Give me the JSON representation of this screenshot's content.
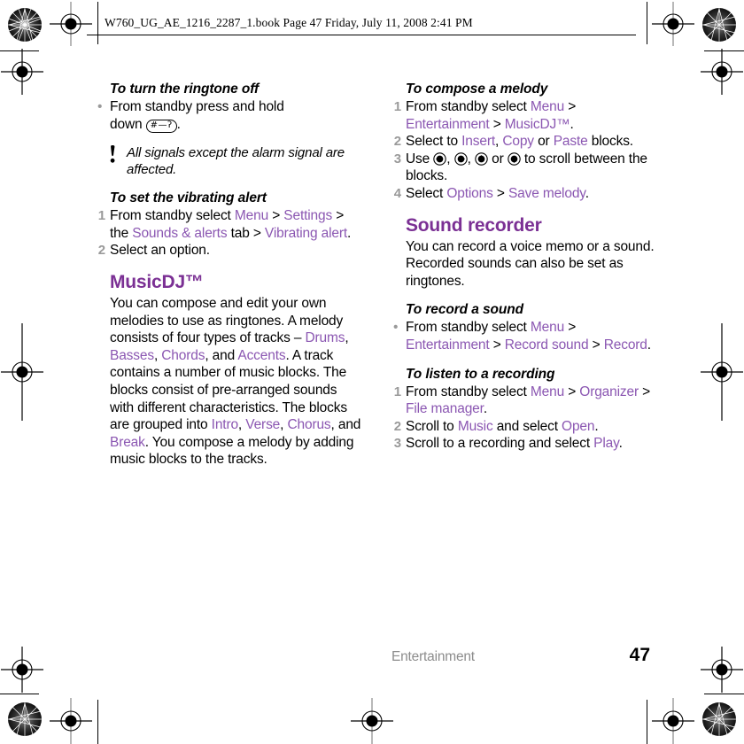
{
  "header": {
    "text": "W760_UG_AE_1216_2287_1.book  Page 47  Friday, July 11, 2008  2:41 PM"
  },
  "colors": {
    "heading_purple": "#7B3094",
    "link_purple": "#8B57B2",
    "step_number_grey": "#9a9a9a",
    "footer_grey": "#8c8c8c"
  },
  "left_column": {
    "ringtone_off": {
      "heading": "To turn the ringtone off",
      "bullet_marker": "•",
      "line1": "From standby press and hold",
      "line2_pre": "down ",
      "keycap_label": "#—ʔ",
      "line2_post": "."
    },
    "note": {
      "icon": "exclamation-mark",
      "text": "All signals except the alarm signal are affected."
    },
    "vibrating_alert": {
      "heading": "To set the vibrating alert",
      "steps": [
        {
          "number": "1",
          "parts": [
            {
              "text": "From standby select ",
              "style": "plain"
            },
            {
              "text": "Menu",
              "style": "link"
            },
            {
              "text": " > ",
              "style": "plain"
            },
            {
              "text": "Settings",
              "style": "link"
            },
            {
              "text": " > the ",
              "style": "plain"
            },
            {
              "text": "Sounds & alerts",
              "style": "link"
            },
            {
              "text": " tab > ",
              "style": "plain"
            },
            {
              "text": "Vibrating alert",
              "style": "link"
            },
            {
              "text": ".",
              "style": "plain"
            }
          ]
        },
        {
          "number": "2",
          "parts": [
            {
              "text": "Select an option.",
              "style": "plain"
            }
          ]
        }
      ]
    },
    "musicdj": {
      "heading": "MusicDJ™",
      "paragraph_parts": [
        {
          "text": "You can compose and edit your own melodies to use as ringtones. A melody consists of four types of tracks – ",
          "style": "plain"
        },
        {
          "text": "Drums",
          "style": "link"
        },
        {
          "text": ", ",
          "style": "plain"
        },
        {
          "text": "Basses",
          "style": "link"
        },
        {
          "text": ", ",
          "style": "plain"
        },
        {
          "text": "Chords",
          "style": "link"
        },
        {
          "text": ", and ",
          "style": "plain"
        },
        {
          "text": "Accents",
          "style": "link"
        },
        {
          "text": ". A track contains a number of music blocks. The blocks consist of pre-arranged sounds with different characteristics. The blocks are grouped into ",
          "style": "plain"
        },
        {
          "text": "Intro",
          "style": "link"
        },
        {
          "text": ", ",
          "style": "plain"
        },
        {
          "text": "Verse",
          "style": "link"
        },
        {
          "text": ", ",
          "style": "plain"
        },
        {
          "text": "Chorus",
          "style": "link"
        },
        {
          "text": ", and ",
          "style": "plain"
        },
        {
          "text": "Break",
          "style": "link"
        },
        {
          "text": ". You compose a melody by adding music blocks to the tracks.",
          "style": "plain"
        }
      ]
    }
  },
  "right_column": {
    "compose_melody": {
      "heading": "To compose a melody",
      "steps": [
        {
          "number": "1",
          "parts": [
            {
              "text": "From standby select ",
              "style": "plain"
            },
            {
              "text": "Menu",
              "style": "link"
            },
            {
              "text": " > ",
              "style": "plain"
            },
            {
              "text": "Entertainment",
              "style": "link"
            },
            {
              "text": " > ",
              "style": "plain"
            },
            {
              "text": "MusicDJ™",
              "style": "link"
            },
            {
              "text": ".",
              "style": "plain"
            }
          ]
        },
        {
          "number": "2",
          "parts": [
            {
              "text": "Select to ",
              "style": "plain"
            },
            {
              "text": "Insert",
              "style": "link"
            },
            {
              "text": ", ",
              "style": "plain"
            },
            {
              "text": "Copy",
              "style": "link"
            },
            {
              "text": " or ",
              "style": "plain"
            },
            {
              "text": "Paste",
              "style": "link"
            },
            {
              "text": " blocks.",
              "style": "plain"
            }
          ]
        },
        {
          "number": "3",
          "parts": [
            {
              "text": "Use ",
              "style": "plain"
            },
            {
              "text": "nav-left-icon",
              "style": "navkey"
            },
            {
              "text": ", ",
              "style": "plain"
            },
            {
              "text": "nav-right-icon",
              "style": "navkey"
            },
            {
              "text": ", ",
              "style": "plain"
            },
            {
              "text": "nav-up-icon",
              "style": "navkey"
            },
            {
              "text": " or ",
              "style": "plain"
            },
            {
              "text": "nav-down-icon",
              "style": "navkey"
            },
            {
              "text": " to scroll between the blocks.",
              "style": "plain"
            }
          ]
        },
        {
          "number": "4",
          "parts": [
            {
              "text": "Select ",
              "style": "plain"
            },
            {
              "text": "Options",
              "style": "link"
            },
            {
              "text": " > ",
              "style": "plain"
            },
            {
              "text": "Save melody",
              "style": "link"
            },
            {
              "text": ".",
              "style": "plain"
            }
          ]
        }
      ]
    },
    "sound_recorder": {
      "heading": "Sound recorder",
      "paragraph": "You can record a voice memo or a sound. Recorded sounds can also be set as ringtones.",
      "record_sound": {
        "heading": "To record a sound",
        "bullet_marker": "•",
        "parts": [
          {
            "text": "From standby select ",
            "style": "plain"
          },
          {
            "text": "Menu",
            "style": "link"
          },
          {
            "text": " > ",
            "style": "plain"
          },
          {
            "text": "Entertainment",
            "style": "link"
          },
          {
            "text": " > ",
            "style": "plain"
          },
          {
            "text": "Record sound",
            "style": "link"
          },
          {
            "text": " > ",
            "style": "plain"
          },
          {
            "text": "Record",
            "style": "link"
          },
          {
            "text": ".",
            "style": "plain"
          }
        ]
      },
      "listen_recording": {
        "heading": "To listen to a recording",
        "steps": [
          {
            "number": "1",
            "parts": [
              {
                "text": "From standby select ",
                "style": "plain"
              },
              {
                "text": "Menu",
                "style": "link"
              },
              {
                "text": " > ",
                "style": "plain"
              },
              {
                "text": "Organizer",
                "style": "link"
              },
              {
                "text": " > ",
                "style": "plain"
              },
              {
                "text": "File manager",
                "style": "link"
              },
              {
                "text": ".",
                "style": "plain"
              }
            ]
          },
          {
            "number": "2",
            "parts": [
              {
                "text": "Scroll to ",
                "style": "plain"
              },
              {
                "text": "Music",
                "style": "link"
              },
              {
                "text": " and select ",
                "style": "plain"
              },
              {
                "text": "Open",
                "style": "link"
              },
              {
                "text": ".",
                "style": "plain"
              }
            ]
          },
          {
            "number": "3",
            "parts": [
              {
                "text": "Scroll to a recording and select ",
                "style": "plain"
              },
              {
                "text": "Play",
                "style": "link"
              },
              {
                "text": ".",
                "style": "plain"
              }
            ]
          }
        ]
      }
    }
  },
  "footer": {
    "section": "Entertainment",
    "page_number": "47"
  }
}
